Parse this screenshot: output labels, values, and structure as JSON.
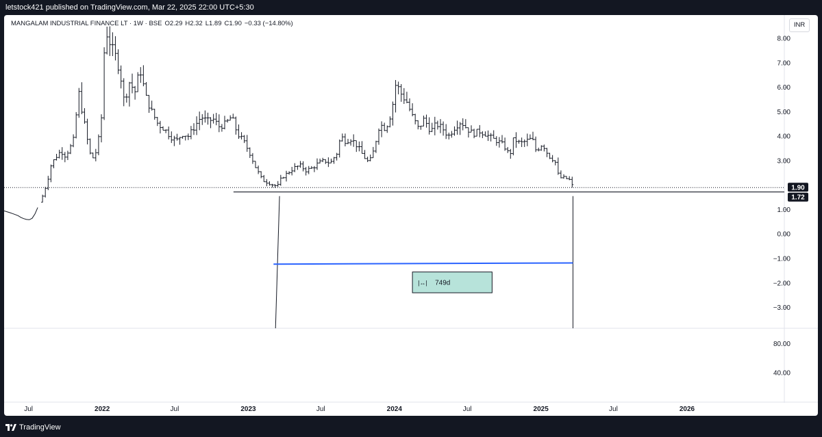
{
  "publish_line": "letstock421 published on TradingView.com, Mar 22, 2025 22:00 UTC+5:30",
  "legend": {
    "symbol": "MANGALAM INDUSTRIAL FINANCE LT · 1W · BSE",
    "open": "O2.29",
    "high": "H2.32",
    "low": "L1.89",
    "close": "C1.90",
    "change": "−0.33 (−14.80%)"
  },
  "currency": "INR",
  "footer_brand": "TradingView",
  "colors": {
    "background": "#131722",
    "pane": "#ffffff",
    "bars": "#131722",
    "trend_line": "#2962ff",
    "range_box": "#b7e3da",
    "price_label": "#131722"
  },
  "chart_data": {
    "type": "ohlc",
    "title": "MANGALAM INDUSTRIAL FINANCE LT · 1W · BSE",
    "x_axis": {
      "range": [
        "2021-05-01",
        "2026-09-01"
      ],
      "tick_labels": [
        {
          "date": "2021-07-01",
          "label": "Jul"
        },
        {
          "date": "2022-01-01",
          "label": "2022"
        },
        {
          "date": "2022-07-01",
          "label": "Jul"
        },
        {
          "date": "2023-01-01",
          "label": "2023"
        },
        {
          "date": "2023-07-01",
          "label": "Jul"
        },
        {
          "date": "2024-01-01",
          "label": "2024"
        },
        {
          "date": "2024-07-01",
          "label": "Jul"
        },
        {
          "date": "2025-01-01",
          "label": "2025"
        },
        {
          "date": "2025-07-01",
          "label": "Jul"
        },
        {
          "date": "2026-01-01",
          "label": "2026"
        }
      ]
    },
    "y_axis": {
      "range": [
        -3.85,
        8.95
      ],
      "tick_labels": [
        "8.00",
        "7.00",
        "6.00",
        "5.00",
        "4.00",
        "3.00",
        "1.00",
        "0.00",
        "−1.00",
        "−2.00",
        "−3.00"
      ],
      "tick_values": [
        8,
        7,
        6,
        5,
        4,
        3,
        1,
        0,
        -1,
        -2,
        -3
      ]
    },
    "sub_pane": {
      "tick_labels": [
        "80.00",
        "40.00"
      ],
      "tick_values": [
        80,
        40
      ],
      "range": [
        0,
        100
      ]
    },
    "price_markers": [
      {
        "label": "1.90",
        "value": 1.9,
        "style": "last-price"
      },
      {
        "label": "1.72",
        "value": 1.72,
        "style": "horizontal-line"
      }
    ],
    "close_path": [
      [
        "2021-05-01",
        0.95
      ],
      [
        "2021-05-20",
        0.85
      ],
      [
        "2021-06-05",
        0.75
      ],
      [
        "2021-06-15",
        0.65
      ],
      [
        "2021-06-25",
        0.6
      ],
      [
        "2021-07-01",
        0.58
      ],
      [
        "2021-07-08",
        0.6
      ],
      [
        "2021-07-15",
        0.75
      ],
      [
        "2021-07-22",
        1.0
      ],
      [
        "2021-07-29",
        1.3
      ],
      [
        "2021-08-05",
        1.55
      ],
      [
        "2021-08-12",
        1.9
      ],
      [
        "2021-08-19",
        2.3
      ],
      [
        "2021-08-26",
        2.8
      ],
      [
        "2021-09-05",
        3.1
      ],
      [
        "2021-09-20",
        3.4
      ],
      [
        "2021-10-01",
        3.2
      ],
      [
        "2021-10-15",
        3.6
      ],
      [
        "2021-10-25",
        4.0
      ],
      [
        "2021-11-01",
        6.0
      ],
      [
        "2021-11-10",
        5.2
      ],
      [
        "2021-11-20",
        4.3
      ],
      [
        "2021-12-01",
        3.3
      ],
      [
        "2021-12-10",
        3.1
      ],
      [
        "2021-12-20",
        3.5
      ],
      [
        "2022-01-01",
        5.0
      ],
      [
        "2022-01-08",
        8.4
      ],
      [
        "2022-01-15",
        8.1
      ],
      [
        "2022-01-25",
        7.6
      ],
      [
        "2022-02-05",
        7.2
      ],
      [
        "2022-02-15",
        6.6
      ],
      [
        "2022-02-25",
        5.4
      ],
      [
        "2022-03-10",
        6.2
      ],
      [
        "2022-03-25",
        5.8
      ],
      [
        "2022-04-05",
        6.8
      ],
      [
        "2022-04-20",
        5.6
      ],
      [
        "2022-05-05",
        5.0
      ],
      [
        "2022-05-20",
        4.5
      ],
      [
        "2022-06-05",
        4.3
      ],
      [
        "2022-06-20",
        4.0
      ],
      [
        "2022-07-05",
        3.8
      ],
      [
        "2022-07-20",
        4.1
      ],
      [
        "2022-08-05",
        4.0
      ],
      [
        "2022-08-20",
        4.4
      ],
      [
        "2022-09-05",
        4.8
      ],
      [
        "2022-09-20",
        4.6
      ],
      [
        "2022-10-05",
        4.7
      ],
      [
        "2022-10-20",
        4.4
      ],
      [
        "2022-11-05",
        4.5
      ],
      [
        "2022-11-20",
        4.8
      ],
      [
        "2022-12-05",
        4.1
      ],
      [
        "2022-12-20",
        3.8
      ],
      [
        "2023-01-05",
        3.3
      ],
      [
        "2023-01-20",
        2.7
      ],
      [
        "2023-02-05",
        2.2
      ],
      [
        "2023-02-20",
        2.1
      ],
      [
        "2023-03-05",
        2.0
      ],
      [
        "2023-03-15",
        1.95
      ],
      [
        "2023-03-25",
        2.3
      ],
      [
        "2023-04-10",
        2.5
      ],
      [
        "2023-04-25",
        2.7
      ],
      [
        "2023-05-10",
        2.8
      ],
      [
        "2023-05-25",
        2.6
      ],
      [
        "2023-06-10",
        2.7
      ],
      [
        "2023-06-25",
        2.9
      ],
      [
        "2023-07-10",
        3.0
      ],
      [
        "2023-07-25",
        2.9
      ],
      [
        "2023-08-10",
        3.3
      ],
      [
        "2023-08-20",
        4.0
      ],
      [
        "2023-09-01",
        3.8
      ],
      [
        "2023-09-15",
        3.9
      ],
      [
        "2023-09-30",
        3.6
      ],
      [
        "2023-10-15",
        3.2
      ],
      [
        "2023-10-30",
        2.9
      ],
      [
        "2023-11-10",
        3.4
      ],
      [
        "2023-11-25",
        4.5
      ],
      [
        "2023-12-10",
        4.3
      ],
      [
        "2023-12-25",
        5.0
      ],
      [
        "2024-01-05",
        6.2
      ],
      [
        "2024-01-15",
        5.8
      ],
      [
        "2024-02-01",
        5.4
      ],
      [
        "2024-02-15",
        4.8
      ],
      [
        "2024-03-01",
        4.3
      ],
      [
        "2024-03-15",
        4.7
      ],
      [
        "2024-04-01",
        4.2
      ],
      [
        "2024-04-15",
        4.5
      ],
      [
        "2024-05-01",
        4.3
      ],
      [
        "2024-05-15",
        4.0
      ],
      [
        "2024-06-01",
        4.4
      ],
      [
        "2024-06-15",
        4.6
      ],
      [
        "2024-07-01",
        4.3
      ],
      [
        "2024-07-15",
        4.1
      ],
      [
        "2024-08-01",
        4.2
      ],
      [
        "2024-08-15",
        4.1
      ],
      [
        "2024-09-01",
        3.9
      ],
      [
        "2024-09-15",
        3.8
      ],
      [
        "2024-10-01",
        3.6
      ],
      [
        "2024-10-15",
        3.2
      ],
      [
        "2024-10-25",
        3.9
      ],
      [
        "2024-11-10",
        3.7
      ],
      [
        "2024-11-25",
        3.8
      ],
      [
        "2024-12-10",
        3.9
      ],
      [
        "2024-12-20",
        3.4
      ],
      [
        "2025-01-05",
        3.7
      ],
      [
        "2025-01-20",
        3.2
      ],
      [
        "2025-02-05",
        3.0
      ],
      [
        "2025-02-15",
        2.3
      ],
      [
        "2025-03-01",
        2.3
      ],
      [
        "2025-03-15",
        2.2
      ],
      [
        "2025-03-22",
        1.9
      ]
    ],
    "drawings": {
      "support_line": {
        "from": "2022-11-25",
        "to": "2026-09-01",
        "value": 1.72
      },
      "vertical_lines": [
        {
          "date_top": "2023-03-20",
          "date_bottom": "2023-03-10",
          "from_value": 1.55,
          "to_value": -3.85
        },
        {
          "date_top": "2025-03-22",
          "date_bottom": "2025-03-22",
          "from_value": 1.55,
          "to_value": -3.85
        }
      ],
      "trend_line": {
        "from": [
          "2023-03-05",
          -1.23
        ],
        "to": [
          "2025-03-22",
          -1.18
        ]
      },
      "date_range_box": {
        "from": "2024-02-15",
        "to": "2024-09-01",
        "top": -1.55,
        "bottom": -2.4,
        "label": "749d"
      }
    }
  }
}
